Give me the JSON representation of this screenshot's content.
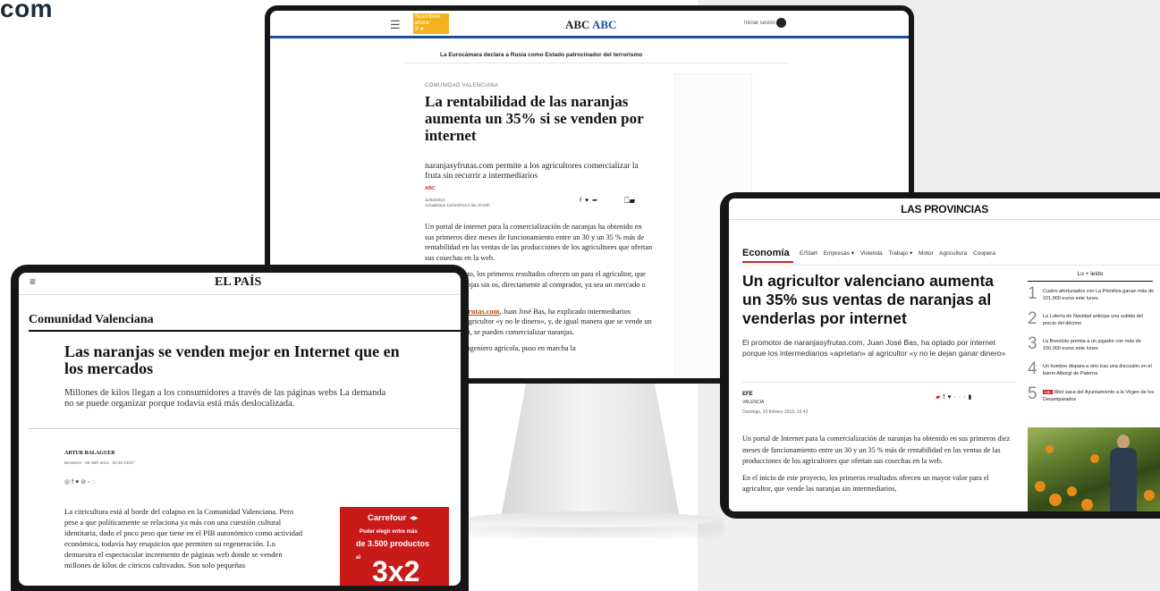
{
  "brand_fragment": "com",
  "monitor": {
    "header": {
      "menu_icon": "hamburger-menu-icon",
      "badge_text": "Suscríbete ahora",
      "badge_small": "3 ★",
      "logo_text": "ABC",
      "logo_accent": "ABC",
      "login_text": "Iniciar sesión",
      "user_icon": "user-icon",
      "accent_color": "#1b4f9c"
    },
    "ticker": "La Eurocámara declara a Rusia como Estado patrocinador del terrorismo",
    "article": {
      "section": "COMUNIDAD VALENCIANA",
      "title": "La rentabilidad de las naranjas aumenta un 35% si se venden por internet",
      "subtitle": "naranjasyfrutas.com permite a los agricultores comercializar la fruta sin recurrir a intermediarios",
      "source": "ABC",
      "date_line1": "11/02/2013",
      "date_line2": "Actualizado 11/02/2013 a las 10:34h.",
      "share_icons": [
        "facebook-icon",
        "twitter-icon",
        "share-icon",
        "bookmark-icon",
        "comment-icon"
      ],
      "paragraph1": "Un portal de internet para la comercialización de naranjas ha obtenido en sus primeros diez meses de funcionamiento entre un 30 y un 35 % más de rentabilidad en las ventas de las producciones de los agricultores que ofertan sus cosechas en la web.",
      "paragraph2": "de este proyecto, los primeros resultados ofrecen un para el agricultor, que vende las naranjas sin os, directamente al comprador, ya sea un mercado o mayorista.",
      "paragraph3_pre": "de",
      "paragraph3_link": "naranjasyfrutas.com",
      "paragraph3_post": ", Juan José Bas, ha explicado intermediarios «aprietan» al agricultor «y no le dinero», y, de igual manera que se vende un coche o un rnet, se pueden comercializar naranjas.",
      "paragraph4": ", agricultor e ingeniero agrícola, puso en marcha la"
    }
  },
  "tablet_left": {
    "menu_icon": "hamburger-menu-icon",
    "logo": "EL PAÍS",
    "section": "Comunidad Valenciana",
    "title": "Las naranjas se venden mejor en Internet que en los mercados",
    "subtitle": "Millones de kilos llegan a los consumidores a través de las páginas webs La demanda no se puede organizar porque todavía está más deslocalizada.",
    "author": "ARTUR BALAGUER",
    "date": "Benidorm - 09 ABR 2012 - 04:30 CEST",
    "share_icons": [
      "whatsapp-icon",
      "facebook-icon",
      "twitter-icon",
      "link-icon",
      "comment-icon"
    ],
    "body": "La citricultura está al borde del colapso en la Comunidad Valenciana. Pero pese a que políticamente se relaciona ya más con una cuestión cultural identitaria, dado el poco peso que tiene en el PIB autonómico como actividad económica, todavía hay resquicios que permiten su regeneración. Lo demuestra el espectacular incremento de páginas web donde se venden millones de kilos de cítricos cultivados. Son solo pequeñas",
    "ad": {
      "brand": "Carrefour",
      "text1": "Poder elegir entre más",
      "text2": "de 3.500 productos",
      "al": "al",
      "big": "3x2",
      "color": "#c91a1a"
    }
  },
  "tablet_right": {
    "logo": "LAS PROVINCIAS",
    "section": "Economía",
    "nav": [
      "E/Start",
      "Empresas ▾",
      "Vivienda",
      "Trabajo ▾",
      "Motor",
      "Agricultura",
      "Coopera"
    ],
    "title": "Un agricultor valenciano aumenta un 35% sus ventas de naranjas al venderlas por internet",
    "subtitle": "El promotor de naranjasyfrutas.com, Juan José Bas, ha optado por internet porque los intermediarios «aprietan» al agricultor «y no le dejan ganar dinero»",
    "source": "EFE",
    "location": "VALENCIA",
    "date": "Domingo, 10 febrero 2013, 13:43",
    "share_icons": [
      "comment-icon",
      "facebook-icon",
      "twitter-icon",
      "more-icon",
      "bookmark-icon"
    ],
    "body1": "Un portal de Internet para la comercialización de naranjas ha obtenido en sus primeros diez meses de funcionamiento entre un 30 y un 35 % más de rentabilidad en las ventas de las producciones de los agricultores que ofertan sus cosechas en la web.",
    "body2": "En el inicio de este proyecto, los primeros resultados ofrecen un mayor valor para el agricultor, que vende las naranjas sin intermediarios,",
    "most_read_title": "Lo + leído",
    "most_read": [
      {
        "num": "1",
        "text": "Cuatro afortunados con La Primitiva ganan más de 101.900 euros este lunes"
      },
      {
        "num": "2",
        "text": "La Lotería de Navidad anticipa una subida del precio del décimo"
      },
      {
        "num": "3",
        "text": "La Bonoloto premia a un jugador con más de 150.000 euros este lunes"
      },
      {
        "num": "4",
        "text": "Un hombre dispara a otro tras una discusión en el barrio Alborgí de Paterna"
      },
      {
        "num": "5",
        "tag": "VID",
        "text": "Ribó saca del Ayuntamiento a la Virgen de los Desamparados"
      }
    ],
    "accent_color": "#c22222"
  }
}
